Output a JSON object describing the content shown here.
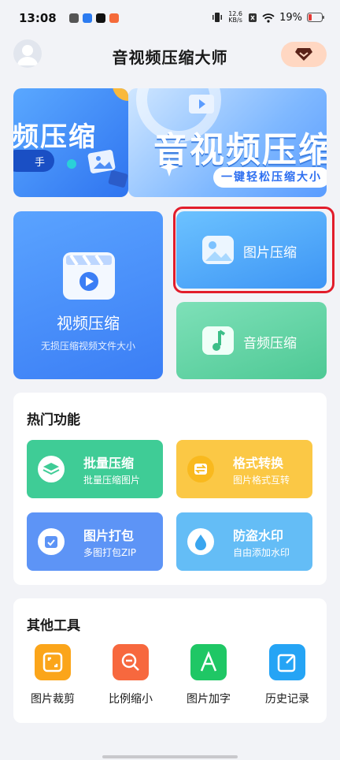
{
  "status_bar": {
    "time": "13:08",
    "speed_value": "12.6",
    "speed_unit": "KB/s",
    "battery": "19%"
  },
  "header": {
    "title": "音视频压缩大师"
  },
  "banners": [
    {
      "title": "频压缩",
      "button": "手"
    },
    {
      "title": "音视频压缩",
      "subtitle": "一键轻松压缩大小"
    }
  ],
  "features": {
    "video": {
      "label": "视频压缩",
      "sub": "无损压缩视频文件大小"
    },
    "image": {
      "label": "图片压缩"
    },
    "audio": {
      "label": "音频压缩"
    }
  },
  "hot": {
    "title": "热门功能",
    "items": [
      {
        "title": "批量压缩",
        "sub": "批量压缩图片",
        "color": "#3fcc96"
      },
      {
        "title": "格式转换",
        "sub": "图片格式互转",
        "color": "#fbc845"
      },
      {
        "title": "图片打包",
        "sub": "多图打包ZIP",
        "color": "#5d94f6"
      },
      {
        "title": "防盗水印",
        "sub": "自由添加水印",
        "color": "#64bdf6"
      }
    ]
  },
  "other": {
    "title": "其他工具",
    "items": [
      {
        "label": "图片裁剪",
        "color": "#fba51a"
      },
      {
        "label": "比例缩小",
        "color": "#f7683e"
      },
      {
        "label": "图片加字",
        "color": "#1fc765"
      },
      {
        "label": "历史记录",
        "color": "#25a4f5"
      }
    ]
  }
}
